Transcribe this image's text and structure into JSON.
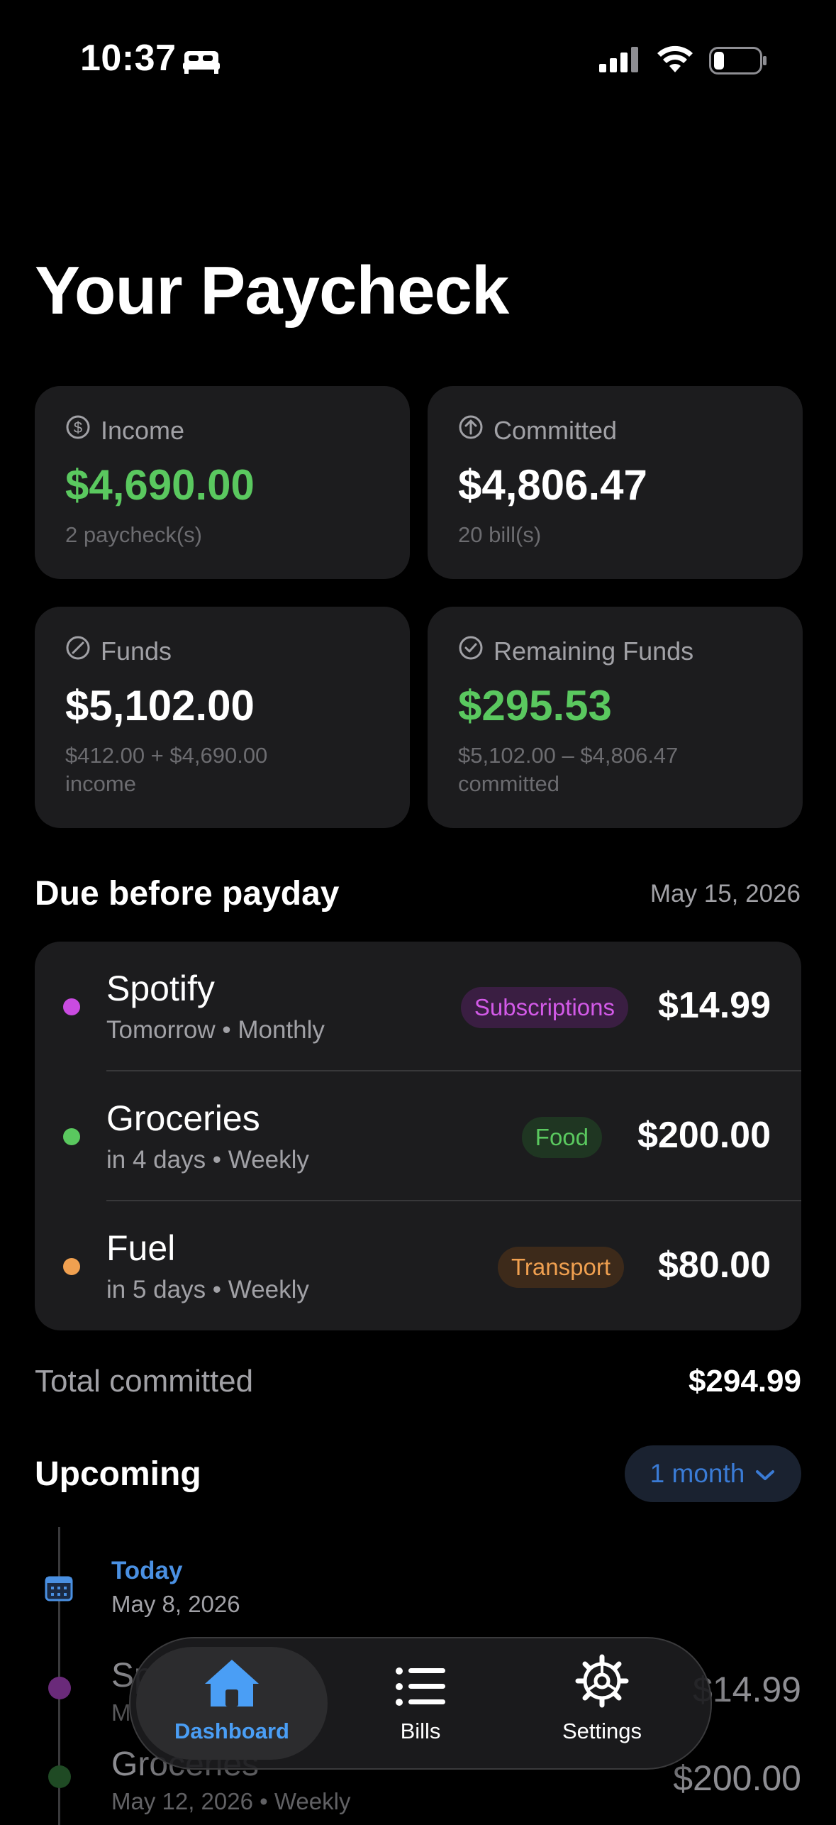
{
  "status": {
    "time": "10:37"
  },
  "page_title": "Your Paycheck",
  "cards": {
    "income": {
      "label": "Income",
      "value": "$4,690.00",
      "sub": "2 paycheck(s)"
    },
    "committed": {
      "label": "Committed",
      "value": "$4,806.47",
      "sub": "20 bill(s)"
    },
    "funds": {
      "label": "Funds",
      "value": "$5,102.00",
      "sub_line1": "$412.00 + $4,690.00",
      "sub_line2": "income"
    },
    "remaining": {
      "label": "Remaining Funds",
      "value": "$295.53",
      "sub_line1": "$5,102.00 – $4,806.47",
      "sub_line2": "committed"
    }
  },
  "due": {
    "title": "Due before payday",
    "date": "May 15, 2026",
    "items": [
      {
        "name": "Spotify",
        "meta": "Tomorrow • Monthly",
        "tag": "Subscriptions",
        "amount": "$14.99",
        "color": "#c94be0"
      },
      {
        "name": "Groceries",
        "meta": "in 4 days • Weekly",
        "tag": "Food",
        "amount": "$200.00",
        "color": "#5ac85f"
      },
      {
        "name": "Fuel",
        "meta": "in 5 days • Weekly",
        "tag": "Transport",
        "amount": "$80.00",
        "color": "#f0a050"
      }
    ],
    "total_label": "Total committed",
    "total_value": "$294.99"
  },
  "upcoming": {
    "title": "Upcoming",
    "range": "1 month",
    "today_label": "Today",
    "today_date": "May 8, 2026",
    "items": [
      {
        "name": "Sp",
        "meta": "M",
        "amount": "$14.99"
      },
      {
        "name": "Groceries",
        "meta": "May 12, 2026 • Weekly",
        "amount": "$200.00"
      }
    ]
  },
  "tabbar": {
    "tabs": [
      {
        "label": "Dashboard",
        "icon": "house-icon",
        "active": true
      },
      {
        "label": "Bills",
        "icon": "list-icon",
        "active": false
      },
      {
        "label": "Settings",
        "icon": "gear-icon",
        "active": false
      }
    ]
  }
}
